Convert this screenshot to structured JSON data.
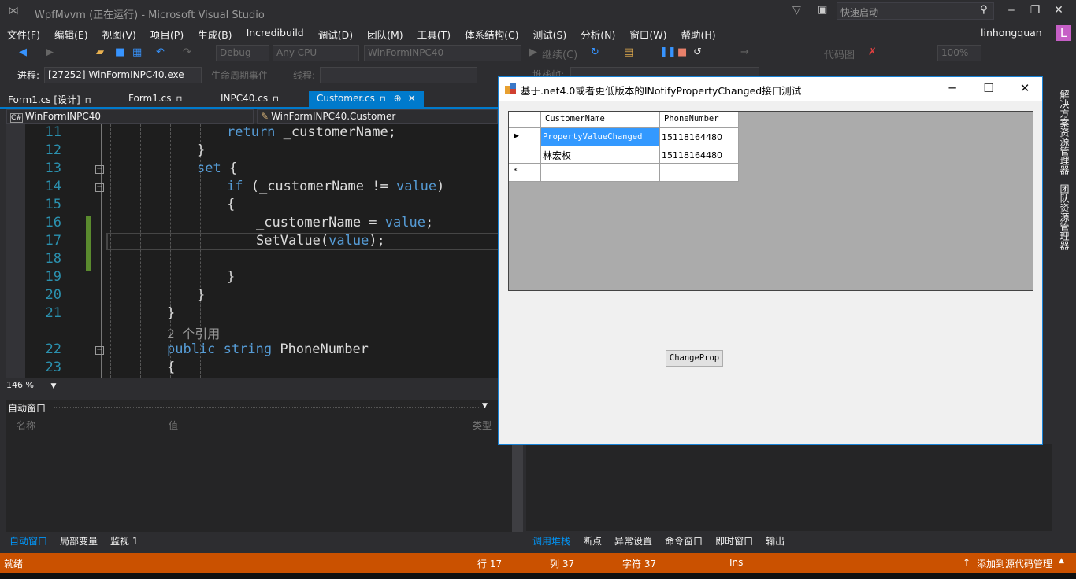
{
  "window": {
    "title": "WpfMvvm (正在运行) - Microsoft Visual Studio",
    "quick_launch_placeholder": "快速启动",
    "user": "linhongquan",
    "avatar_letter": "L"
  },
  "menu": [
    "文件(F)",
    "编辑(E)",
    "视图(V)",
    "项目(P)",
    "生成(B)",
    "Incredibuild",
    "调试(D)",
    "团队(M)",
    "工具(T)",
    "体系结构(C)",
    "测试(S)",
    "分析(N)",
    "窗口(W)",
    "帮助(H)"
  ],
  "toolbar": {
    "config": "Debug",
    "platform": "Any CPU",
    "startup": "WinFormINPC40",
    "continue": "继续(C)",
    "codemap": "代码图",
    "zoom": "100%"
  },
  "debugbar": {
    "process_label": "进程:",
    "process": "[27252] WinFormINPC40.exe",
    "lifecycle": "生命周期事件",
    "thread_label": "线程:",
    "stack_label": "堆栈帧:"
  },
  "tabs": [
    {
      "label": "Form1.cs [设计]",
      "lock": "ǝ"
    },
    {
      "label": "Form1.cs",
      "lock": "ǝ"
    },
    {
      "label": "INPC40.cs",
      "lock": "ǝ"
    },
    {
      "label": "Customer.cs",
      "lock": "ǝ",
      "active": true
    }
  ],
  "navbar": {
    "project": "WinFormINPC40",
    "type": "WinFormINPC40.Customer"
  },
  "code": {
    "ref_count": "2 个引用",
    "zoom": "146 %",
    "lines": [
      {
        "n": "11",
        "parts": [
          [
            "kw",
            "return"
          ],
          [
            "",
            " _customerName;"
          ]
        ]
      },
      {
        "n": "12",
        "parts": [
          [
            "",
            "}"
          ]
        ]
      },
      {
        "n": "13",
        "parts": [
          [
            "kw",
            "set"
          ],
          [
            "",
            " {"
          ]
        ]
      },
      {
        "n": "14",
        "parts": [
          [
            "kw",
            "if"
          ],
          [
            "",
            " (_customerName != "
          ],
          [
            "kw",
            "value"
          ],
          [
            "",
            ")"
          ]
        ]
      },
      {
        "n": "15",
        "parts": [
          [
            "",
            "{"
          ]
        ]
      },
      {
        "n": "16",
        "parts": [
          [
            "",
            "_customerName = "
          ],
          [
            "kw",
            "value"
          ],
          [
            "",
            ";"
          ]
        ]
      },
      {
        "n": "17",
        "parts": [
          [
            "",
            "SetValue("
          ],
          [
            "kw",
            "value"
          ],
          [
            "",
            ");"
          ]
        ]
      },
      {
        "n": "18",
        "parts": []
      },
      {
        "n": "19",
        "parts": [
          [
            "",
            "}"
          ]
        ]
      },
      {
        "n": "20",
        "parts": [
          [
            "",
            "}"
          ]
        ]
      },
      {
        "n": "21",
        "parts": [
          [
            "",
            "}"
          ]
        ]
      },
      {
        "n": "",
        "parts": [
          [
            "ref",
            "2 个引用"
          ]
        ]
      },
      {
        "n": "22",
        "parts": [
          [
            "kw",
            "public"
          ],
          [
            "",
            " "
          ],
          [
            "kw",
            "string"
          ],
          [
            "",
            " PhoneNumber"
          ]
        ]
      },
      {
        "n": "23",
        "parts": [
          [
            "",
            "{"
          ]
        ]
      }
    ]
  },
  "auto_window": {
    "title": "自动窗口",
    "columns": [
      "名称",
      "值",
      "类型"
    ]
  },
  "bottom_tabs_left": [
    "自动窗口",
    "局部变量",
    "监视 1"
  ],
  "bottom_tabs_right": [
    "调用堆栈",
    "断点",
    "异常设置",
    "命令窗口",
    "即时窗口",
    "输出"
  ],
  "right_strip": [
    "解决方案资源管理器",
    "团队资源管理器"
  ],
  "status": {
    "ready": "就绪",
    "line": "行 17",
    "col": "列 37",
    "char": "字符 37",
    "mode": "Ins",
    "source_control": "添加到源代码管理"
  },
  "dialog": {
    "title": "基于.net4.0或者更低版本的INotifyPropertyChanged接口测试",
    "columns": [
      "CustomerName",
      "PhoneNumber"
    ],
    "rows": [
      {
        "marker": "▶",
        "name": "PropertyValueChanged",
        "phone": "15118164480"
      },
      {
        "marker": "",
        "name": "林宏权",
        "phone": "15118164480"
      },
      {
        "marker": "*",
        "name": "",
        "phone": ""
      }
    ],
    "button": "ChangeProp"
  }
}
